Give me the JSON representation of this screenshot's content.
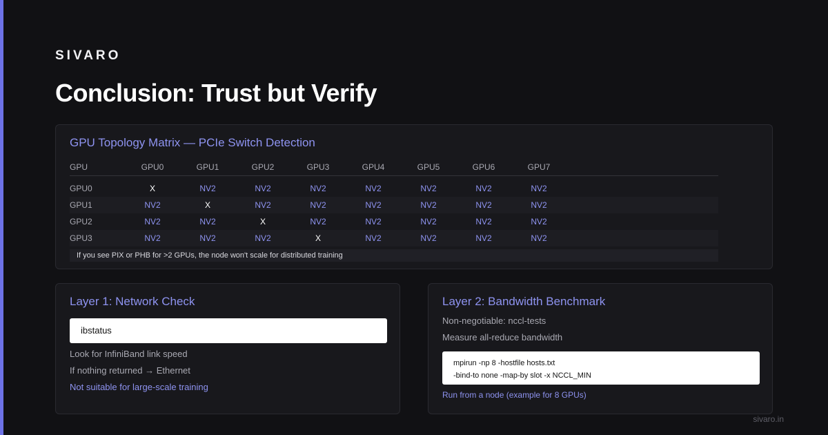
{
  "brand": "SIVARO",
  "title": "Conclusion: Trust but Verify",
  "topology": {
    "title": "GPU Topology Matrix — PCIe Switch Detection",
    "header": [
      "GPU",
      "GPU0",
      "GPU1",
      "GPU2",
      "GPU3",
      "GPU4",
      "GPU5",
      "GPU6",
      "GPU7"
    ],
    "rows": [
      {
        "label": "GPU0",
        "cells": [
          "X",
          "NV2",
          "NV2",
          "NV2",
          "NV2",
          "NV2",
          "NV2",
          "NV2"
        ]
      },
      {
        "label": "GPU1",
        "cells": [
          "NV2",
          "X",
          "NV2",
          "NV2",
          "NV2",
          "NV2",
          "NV2",
          "NV2"
        ]
      },
      {
        "label": "GPU2",
        "cells": [
          "NV2",
          "NV2",
          "X",
          "NV2",
          "NV2",
          "NV2",
          "NV2",
          "NV2"
        ]
      },
      {
        "label": "GPU3",
        "cells": [
          "NV2",
          "NV2",
          "NV2",
          "X",
          "NV2",
          "NV2",
          "NV2",
          "NV2"
        ]
      }
    ],
    "note": "If you see PIX or PHB for >2 GPUs, the node won't scale for distributed training"
  },
  "layer1": {
    "title": "Layer 1: Network Check",
    "command": "ibstatus",
    "lines": [
      "Look for InfiniBand link speed",
      "If nothing returned → Ethernet"
    ],
    "link": "Not suitable for large-scale training"
  },
  "layer2": {
    "title": "Layer 2: Bandwidth Benchmark",
    "lines": [
      "Non-negotiable: nccl-tests",
      "Measure all-reduce bandwidth"
    ],
    "command_lines": [
      "mpirun -np 8 -hostfile hosts.txt",
      "-bind-to none -map-by slot -x NCCL_MIN"
    ],
    "link": "Run from a node (example for 8 GPUs)"
  },
  "footer": "sivaro.in",
  "colors": {
    "accent": "#6d72e6",
    "link": "#8e93f0",
    "background": "#111114"
  }
}
